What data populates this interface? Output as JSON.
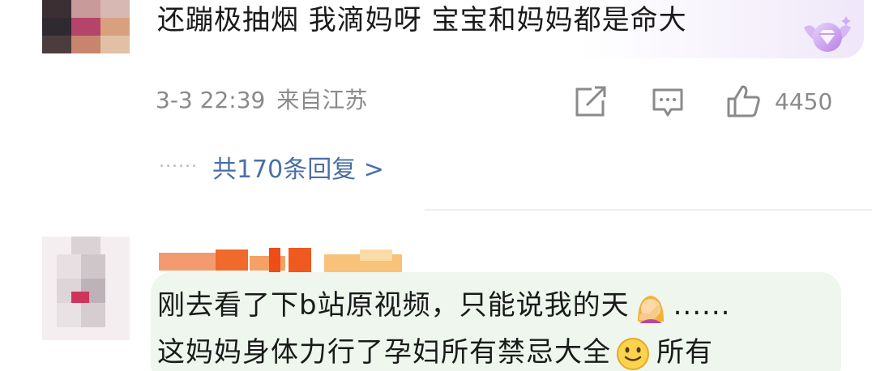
{
  "comment1": {
    "text": "还蹦极抽烟 我滴妈呀 宝宝和妈妈都是命大",
    "time": "3-3 22:39",
    "location": "来自江苏",
    "like_count": "4450",
    "replies_dots": "······",
    "replies_link": "共170条回复 >"
  },
  "comment2": {
    "line1": "刚去看了下b站原视频，只能说我的天",
    "line1_suffix": "......",
    "line2": "这妈妈身体力行了孕妇所有禁忌大全",
    "line2_suffix": "所有"
  },
  "icons": {
    "share": "share-icon",
    "comment": "comment-icon",
    "like": "thumbs-up-icon",
    "badge": "diamond-badge-icon",
    "facepalm": "facepalm-emoji",
    "smile": "smile-emoji"
  },
  "colors": {
    "text": "#1a1a1a",
    "meta": "#8a8a8a",
    "link": "#4a6fa5",
    "bubble_green": "#eef6ee",
    "badge_purple": "#b77ee8"
  }
}
